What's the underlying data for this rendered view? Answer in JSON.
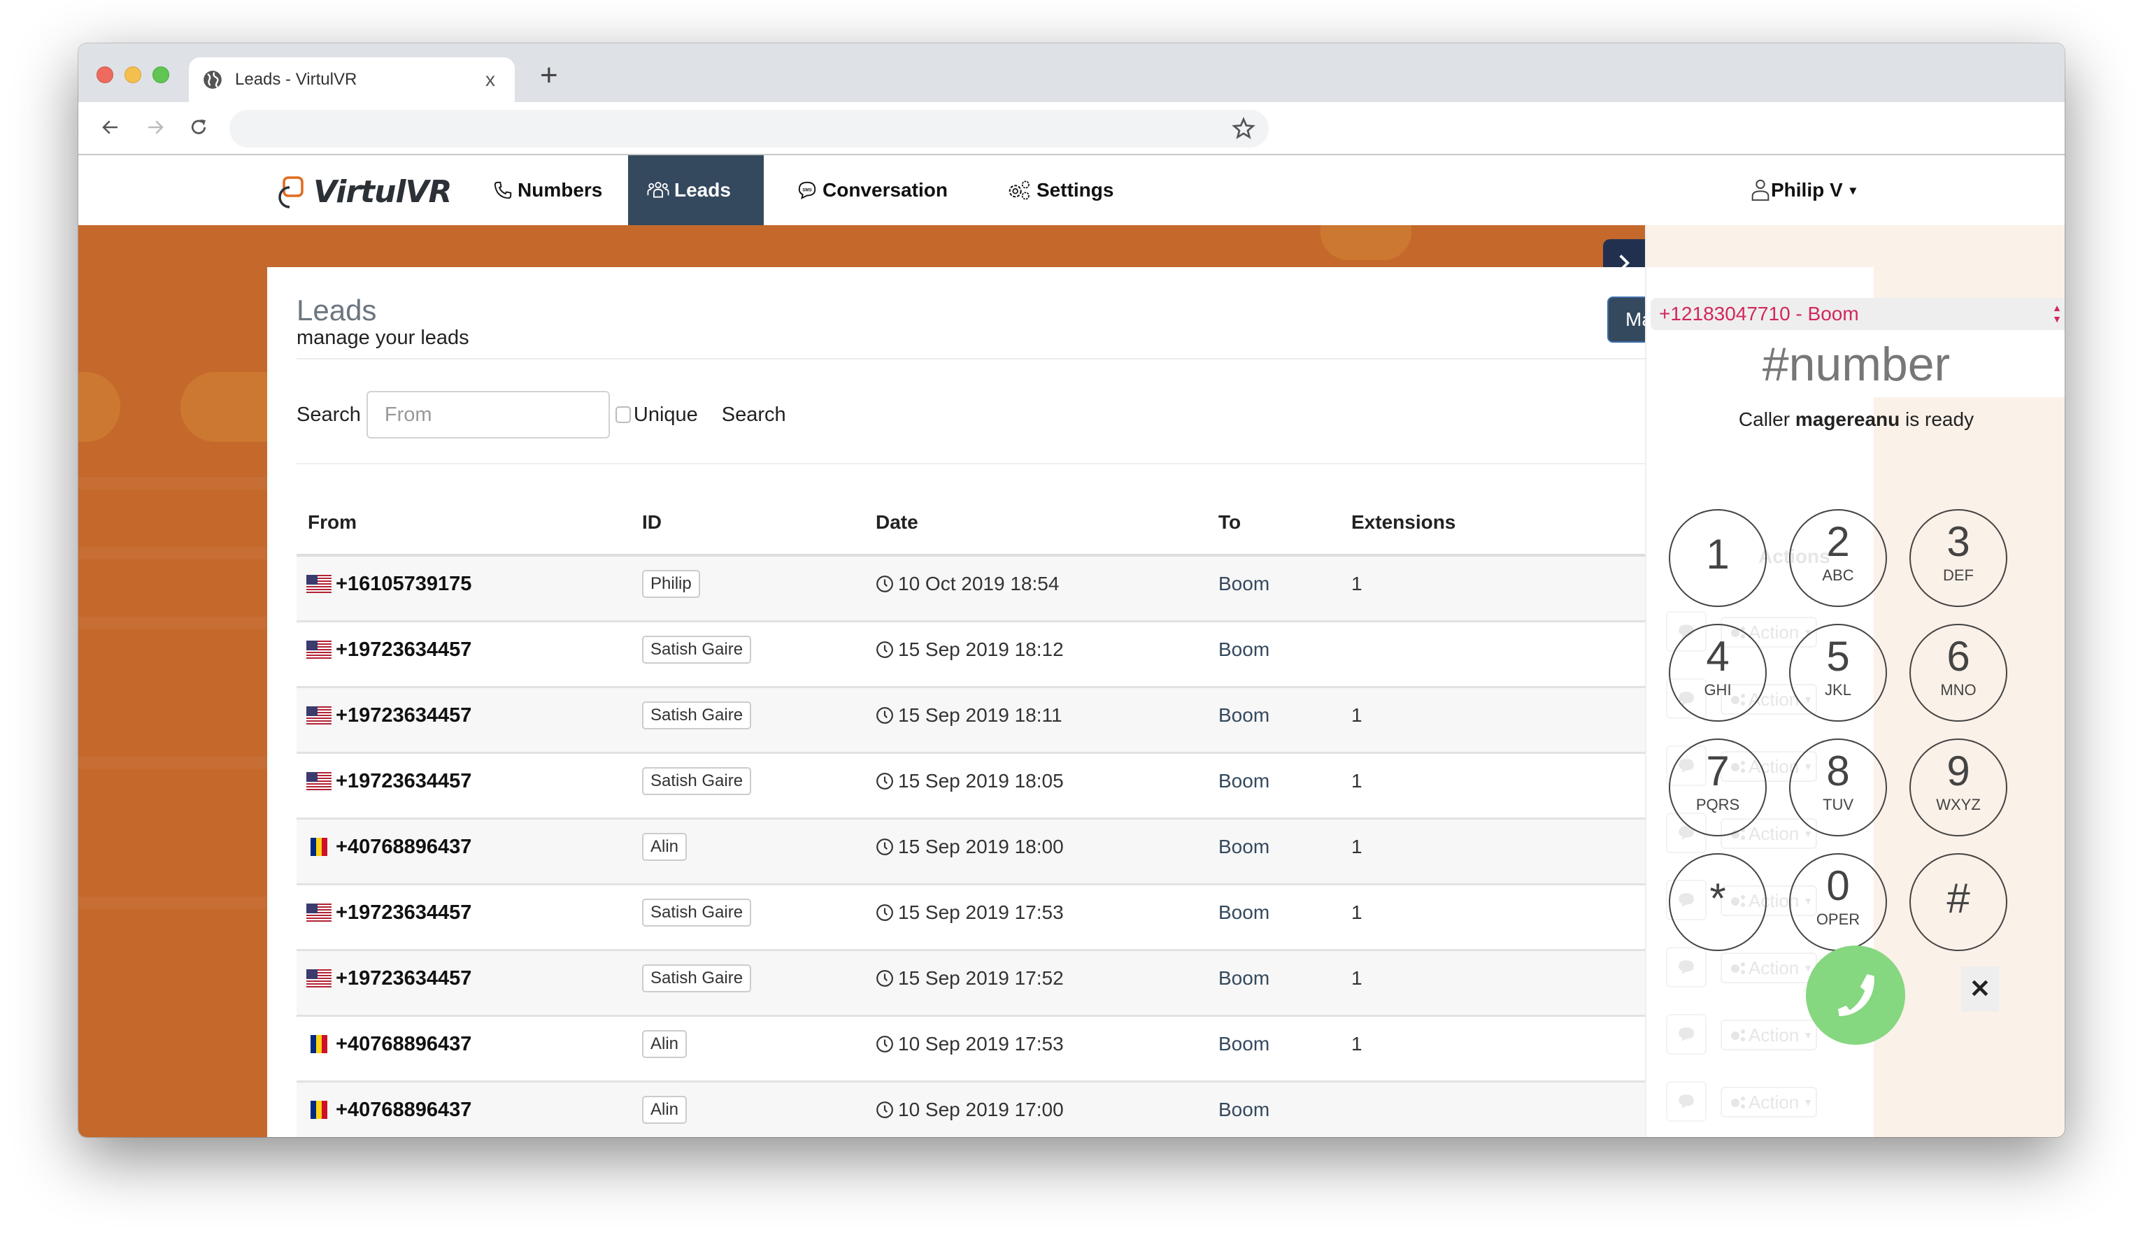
{
  "browser": {
    "tab_title": "Leads - VirtulVR",
    "tab_close": "x",
    "new_tab": "+",
    "address": ""
  },
  "nav": {
    "brand": "VirtulVR",
    "items": [
      {
        "label": "Numbers",
        "icon": "phone-icon",
        "active": false
      },
      {
        "label": "Leads",
        "icon": "users-icon",
        "active": true
      },
      {
        "label": "Conversation",
        "icon": "sms-icon",
        "active": false
      },
      {
        "label": "Settings",
        "icon": "gears-icon",
        "active": false
      }
    ],
    "user": "Philip V",
    "user_caret": "▾"
  },
  "leads": {
    "title": "Leads",
    "subtitle": "manage your leads",
    "mass_sms_label": "Mass SMS",
    "search_label": "Search",
    "search_placeholder": "From",
    "unique_label": "Unique",
    "unique_checked": false,
    "search_button": "Search",
    "columns": [
      "From",
      "ID",
      "Date",
      "To",
      "Extensions",
      "Actions"
    ],
    "rows": [
      {
        "country": "US",
        "from": "+16105739175",
        "id": "Philip",
        "date": "10 Oct 2019 18:54",
        "to": "Boom",
        "extensions": "1"
      },
      {
        "country": "US",
        "from": "+19723634457",
        "id": "Satish Gaire",
        "date": "15 Sep 2019 18:12",
        "to": "Boom",
        "extensions": ""
      },
      {
        "country": "US",
        "from": "+19723634457",
        "id": "Satish Gaire",
        "date": "15 Sep 2019 18:11",
        "to": "Boom",
        "extensions": "1"
      },
      {
        "country": "US",
        "from": "+19723634457",
        "id": "Satish Gaire",
        "date": "15 Sep 2019 18:05",
        "to": "Boom",
        "extensions": "1"
      },
      {
        "country": "RO",
        "from": "+40768896437",
        "id": "Alin",
        "date": "15 Sep 2019 18:00",
        "to": "Boom",
        "extensions": "1"
      },
      {
        "country": "US",
        "from": "+19723634457",
        "id": "Satish Gaire",
        "date": "15 Sep 2019 17:53",
        "to": "Boom",
        "extensions": "1"
      },
      {
        "country": "US",
        "from": "+19723634457",
        "id": "Satish Gaire",
        "date": "15 Sep 2019 17:52",
        "to": "Boom",
        "extensions": "1"
      },
      {
        "country": "RO",
        "from": "+40768896437",
        "id": "Alin",
        "date": "10 Sep 2019 17:53",
        "to": "Boom",
        "extensions": "1"
      },
      {
        "country": "RO",
        "from": "+40768896437",
        "id": "Alin",
        "date": "10 Sep 2019 17:00",
        "to": "Boom",
        "extensions": ""
      }
    ],
    "row_action_label": "Action"
  },
  "dialer": {
    "selected_number": "+12183047710 - Boom",
    "display": "#number",
    "caller_prefix": "Caller",
    "caller_name": "magereanu",
    "caller_suffix": "is ready",
    "keys": [
      {
        "digit": "1",
        "letters": ""
      },
      {
        "digit": "2",
        "letters": "ABC"
      },
      {
        "digit": "3",
        "letters": "DEF"
      },
      {
        "digit": "4",
        "letters": "GHI"
      },
      {
        "digit": "5",
        "letters": "JKL"
      },
      {
        "digit": "6",
        "letters": "MNO"
      },
      {
        "digit": "7",
        "letters": "PQRS"
      },
      {
        "digit": "8",
        "letters": "TUV"
      },
      {
        "digit": "9",
        "letters": "WXYZ"
      },
      {
        "digit": "*",
        "letters": ""
      },
      {
        "digit": "0",
        "letters": "OPER"
      },
      {
        "digit": "#",
        "letters": ""
      }
    ],
    "clear_label": "✕"
  },
  "colors": {
    "nav_active": "#34495e",
    "orange_bg": "#c4692b",
    "dialer_bg": "#faf1e8",
    "call_green": "#85d780",
    "number_select_text": "#d1285a",
    "link": "#34495e"
  }
}
